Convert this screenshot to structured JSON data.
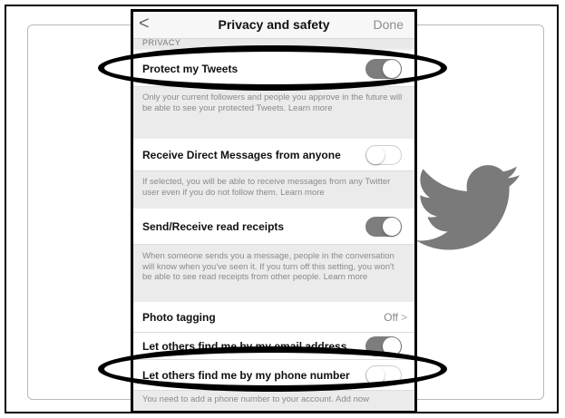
{
  "nav": {
    "back_icon": "chevron-left-icon",
    "back_glyph": "<",
    "title": "Privacy and safety",
    "done": "Done"
  },
  "section": {
    "header": "PRIVACY"
  },
  "settings": [
    {
      "label": "Protect my Tweets",
      "toggle": "on"
    },
    {
      "label": "Receive Direct Messages from anyone",
      "toggle": "off"
    },
    {
      "label": "Send/Receive read receipts",
      "toggle": "on"
    },
    {
      "label": "Photo tagging",
      "value": "Off",
      "chevron": ">"
    },
    {
      "label": "Let others find me by my email address",
      "toggle": "on"
    },
    {
      "label": "Let others find me by my phone number",
      "toggle": "off"
    }
  ],
  "descriptions": {
    "protect": "Only your current followers and people you approve in the future will be able to see your protected Tweets. Learn more",
    "dm": "If selected, you will be able to receive messages from any Twitter user even if you do not follow them. Learn more",
    "receipts": "When someone sends you a message, people in the conversation will know when you've seen it. If you turn off this setting, you won't be able to see read receipts from other people. Learn more",
    "phone": "You need to add a phone number to your account. Add now"
  },
  "colors": {
    "toggle_on": "#7d7d7d",
    "annotation_ellipse": "#000000",
    "bird": "#7a7a7a"
  },
  "decor": {
    "bird_icon": "twitter-bird-icon"
  }
}
